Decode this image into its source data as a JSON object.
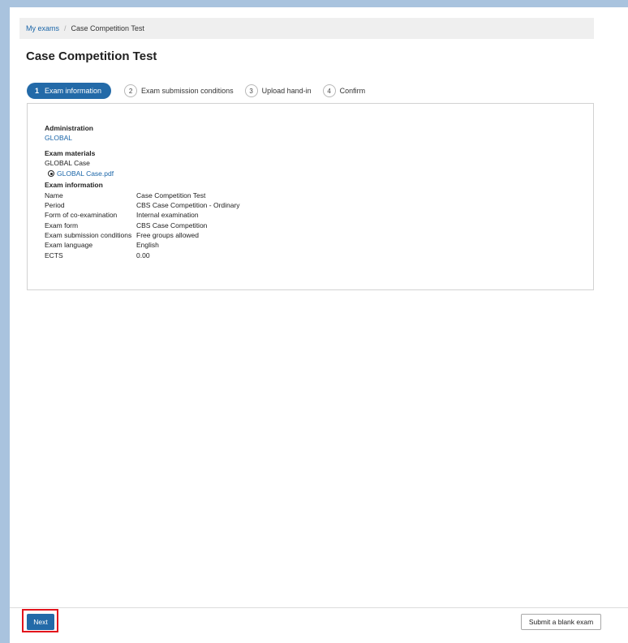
{
  "breadcrumb": {
    "home": "My exams",
    "separator": "/",
    "current": "Case Competition Test"
  },
  "page_title": "Case Competition Test",
  "steps": [
    {
      "number": "1",
      "label": "Exam information",
      "active": true
    },
    {
      "number": "2",
      "label": "Exam submission conditions",
      "active": false
    },
    {
      "number": "3",
      "label": "Upload hand-in",
      "active": false
    },
    {
      "number": "4",
      "label": "Confirm",
      "active": false
    }
  ],
  "administration": {
    "heading": "Administration",
    "value": "GLOBAL"
  },
  "materials": {
    "heading": "Exam materials",
    "name": "GLOBAL Case",
    "file": "GLOBAL Case.pdf",
    "file_icon": "download-icon"
  },
  "exam_info": {
    "heading": "Exam information",
    "rows": [
      {
        "label": "Name",
        "value": "Case Competition Test"
      },
      {
        "label": "Period",
        "value": "CBS Case Competition - Ordinary"
      },
      {
        "label": "Form of co-examination",
        "value": "Internal examination"
      },
      {
        "label": "Exam form",
        "value": "CBS Case Competition"
      },
      {
        "label": "Exam submission conditions",
        "value": "Free groups allowed"
      },
      {
        "label": "Exam language",
        "value": "English"
      },
      {
        "label": "ECTS",
        "value": "0.00"
      }
    ]
  },
  "footer": {
    "next_label": "Next",
    "blank_label": "Submit a blank exam"
  },
  "colors": {
    "accent": "#236aa8",
    "link": "#1a65a8",
    "highlight": "#e3141c",
    "frame": "#a9c3de"
  }
}
